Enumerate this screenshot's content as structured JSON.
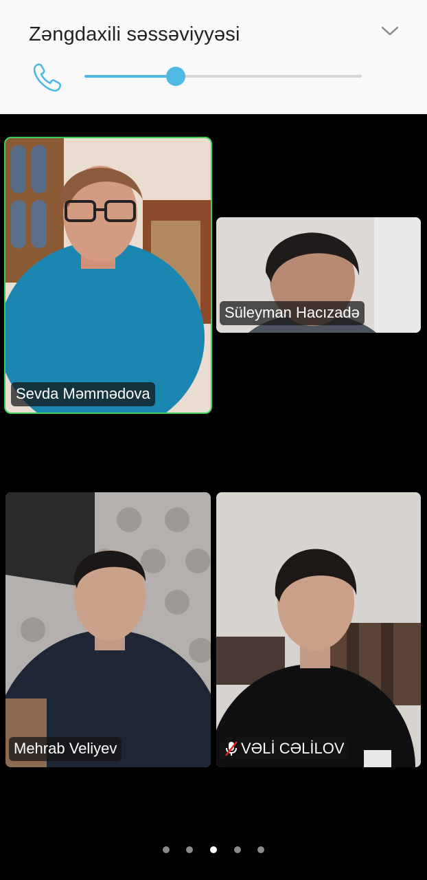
{
  "volume_panel": {
    "title": "Zəngdaxili səssəviyyəsi",
    "level_fraction": 0.33,
    "accent_color": "#4fb9e3",
    "icons": [
      "phone-icon",
      "chevron-down-icon"
    ]
  },
  "participants": [
    {
      "name": "Sevda Məmmədova",
      "active_speaker": true,
      "muted": false
    },
    {
      "name": "Süleyman Hacızadə",
      "active_speaker": false,
      "muted": false
    },
    {
      "name": "Mehrab Veliyev",
      "active_speaker": false,
      "muted": false
    },
    {
      "name": "VƏLİ CƏLİLOV",
      "active_speaker": false,
      "muted": true
    }
  ],
  "pager": {
    "count": 5,
    "active_index": 2
  },
  "colors": {
    "active_border": "#3ed05a",
    "background": "#000000"
  }
}
